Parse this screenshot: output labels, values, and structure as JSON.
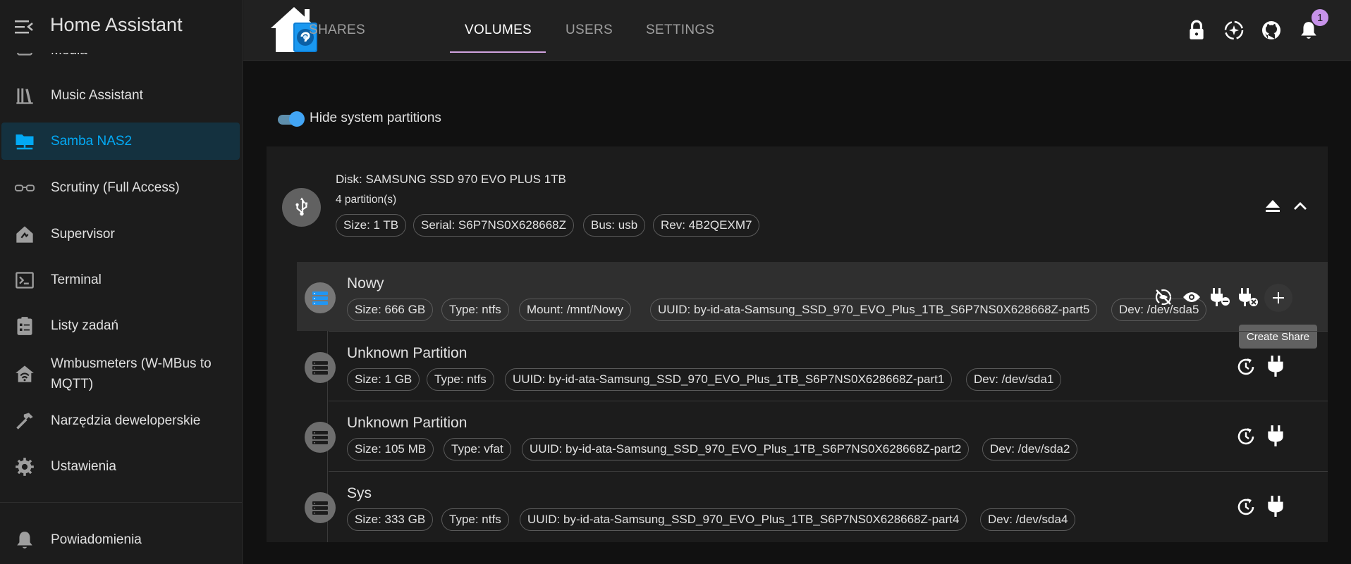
{
  "sidebar": {
    "title": "Home Assistant",
    "partial_item": "Media",
    "items": [
      {
        "label": "Music Assistant",
        "icon": "music-library-icon"
      },
      {
        "label": "Samba NAS2",
        "icon": "nas-folder-icon",
        "active": true
      },
      {
        "label": "Scrutiny (Full Access)",
        "icon": "glasses-icon"
      },
      {
        "label": "Supervisor",
        "icon": "supervisor-icon"
      },
      {
        "label": "Terminal",
        "icon": "terminal-icon"
      },
      {
        "label": "Listy zadań",
        "icon": "clipboard-list-icon"
      },
      {
        "label": "Wmbusmeters (W-MBus to",
        "label2": "MQTT)",
        "icon": "home-wifi-icon"
      },
      {
        "label": "Narzędzia deweloperskie",
        "icon": "hammer-icon"
      },
      {
        "label": "Ustawienia",
        "icon": "gear-icon"
      }
    ],
    "notifications": "Powiadomienia"
  },
  "tabs": [
    "SHARES",
    "VOLUMES",
    "USERS",
    "SETTINGS"
  ],
  "active_tab": "VOLUMES",
  "top_icons": [
    "lock-icon",
    "sync-icon",
    "github-icon",
    "bell-icon"
  ],
  "notification_count": "1",
  "toggle": {
    "label": "Hide system partitions",
    "on": true
  },
  "disk": {
    "title": "Disk: SAMSUNG SSD 970 EVO PLUS 1TB",
    "partitions": "4 partition(s)",
    "chips": [
      "Size: 1 TB",
      "Serial: S6P7NS0X628668Z",
      "Bus: usb",
      "Rev: 4B2QEXM7"
    ]
  },
  "partitions": [
    {
      "title": "Nowy",
      "chips": [
        "Size: 666 GB",
        "Type: ntfs",
        "Mount: /mnt/Nowy",
        "UUID: by-id-ata-Samsung_SSD_970_EVO_Plus_1TB_S6P7NS0X628668Z-part5",
        "Dev: /dev/sda5"
      ]
    },
    {
      "title": "Unknown Partition",
      "chips": [
        "Size: 1 GB",
        "Type: ntfs",
        "UUID: by-id-ata-Samsung_SSD_970_EVO_Plus_1TB_S6P7NS0X628668Z-part1",
        "Dev: /dev/sda1"
      ]
    },
    {
      "title": "Unknown Partition",
      "chips": [
        "Size: 105 MB",
        "Type: vfat",
        "UUID: by-id-ata-Samsung_SSD_970_EVO_Plus_1TB_S6P7NS0X628668Z-part2",
        "Dev: /dev/sda2"
      ]
    },
    {
      "title": "Sys",
      "chips": [
        "Size: 333 GB",
        "Type: ntfs",
        "UUID: by-id-ata-Samsung_SSD_970_EVO_Plus_1TB_S6P7NS0X628668Z-part4",
        "Dev: /dev/sda4"
      ]
    }
  ],
  "tooltip": "Create Share"
}
